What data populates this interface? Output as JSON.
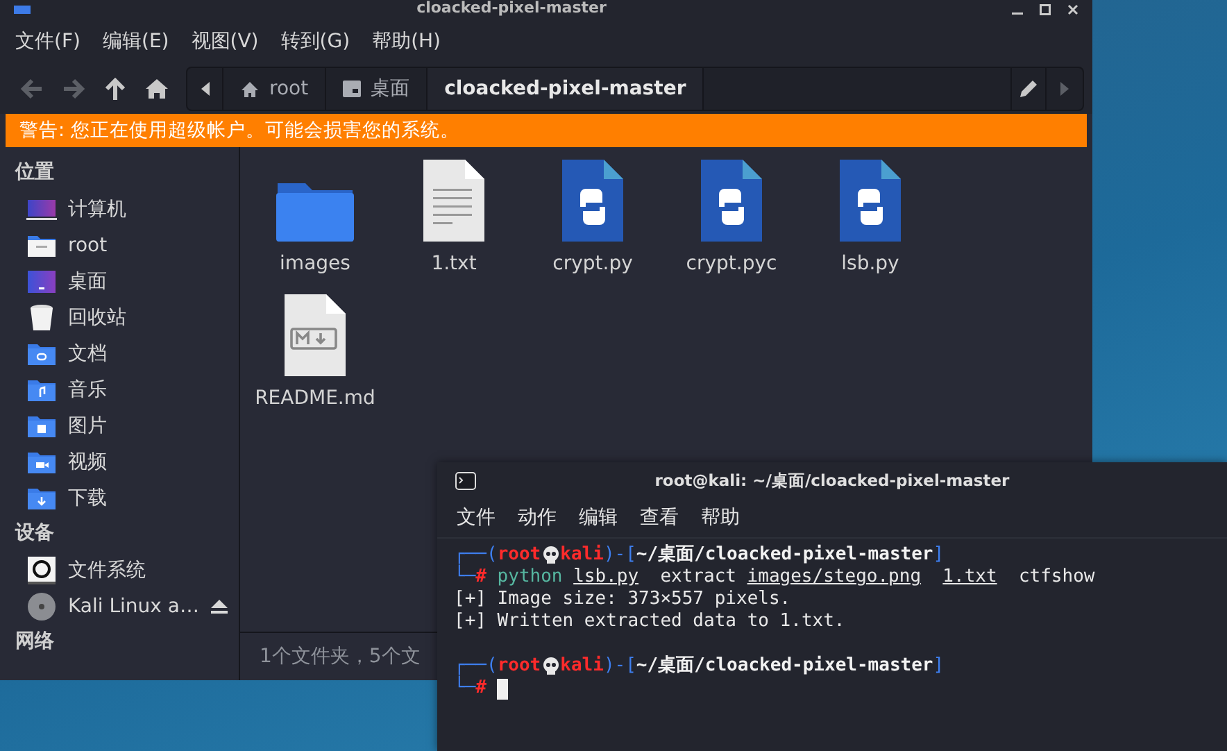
{
  "file_manager": {
    "title": "cloacked-pixel-master",
    "menu": [
      "文件(F)",
      "编辑(E)",
      "视图(V)",
      "转到(G)",
      "帮助(H)"
    ],
    "path": [
      {
        "label": "root",
        "kind": "home",
        "selected": false
      },
      {
        "label": "桌面",
        "kind": "desktop",
        "selected": false
      },
      {
        "label": "cloacked-pixel-master",
        "kind": "plain",
        "selected": true
      }
    ],
    "warning": "警告: 您正在使用超级帐户。可能会损害您的系统。",
    "sidebar": [
      {
        "heading": "位置",
        "items": [
          {
            "label": "计算机",
            "kind": "computer"
          },
          {
            "label": "root",
            "kind": "home"
          },
          {
            "label": "桌面",
            "kind": "desktop"
          },
          {
            "label": "回收站",
            "kind": "trash"
          },
          {
            "label": "文档",
            "kind": "documents"
          },
          {
            "label": "音乐",
            "kind": "music"
          },
          {
            "label": "图片",
            "kind": "pictures"
          },
          {
            "label": "视频",
            "kind": "videos"
          },
          {
            "label": "下载",
            "kind": "downloads"
          }
        ]
      },
      {
        "heading": "设备",
        "items": [
          {
            "label": "文件系统",
            "kind": "disk"
          },
          {
            "label": "Kali Linux a…",
            "kind": "optical",
            "eject": true
          }
        ]
      },
      {
        "heading": "网络"
      }
    ],
    "files": [
      {
        "name": "images",
        "kind": "folder"
      },
      {
        "name": "1.txt",
        "kind": "text"
      },
      {
        "name": "crypt.py",
        "kind": "python"
      },
      {
        "name": "crypt.pyc",
        "kind": "python"
      },
      {
        "name": "lsb.py",
        "kind": "python"
      },
      {
        "name": "README.md",
        "kind": "markdown"
      }
    ],
    "status": "1个文件夹，5个文"
  },
  "terminal": {
    "title": "root@kali: ~/桌面/cloacked-pixel-master",
    "menu": [
      "文件",
      "动作",
      "编辑",
      "查看",
      "帮助"
    ],
    "lines": [
      {
        "kind": "prompt",
        "open": "┌──(",
        "user": "root",
        "host": "kali",
        "mid": ")-[",
        "path": "~/桌面/cloacked-pixel-master",
        "close": "]"
      },
      {
        "kind": "input",
        "corner": "└─",
        "hash": "#",
        "program": "python",
        "args": [
          {
            "kind": "file",
            "text": "lsb.py"
          },
          {
            "kind": "word",
            "text": "extract"
          },
          {
            "kind": "file",
            "text": "images/stego.png"
          },
          {
            "kind": "file",
            "text": "1.txt"
          },
          {
            "kind": "word",
            "text": "ctfshow"
          }
        ]
      },
      {
        "kind": "output",
        "text": "[+] Image size: 373×557 pixels."
      },
      {
        "kind": "output",
        "text": "[+] Written extracted data to 1.txt."
      },
      {
        "kind": "blank"
      },
      {
        "kind": "prompt",
        "open": "┌──(",
        "user": "root",
        "host": "kali",
        "mid": ")-[",
        "path": "~/桌面/cloacked-pixel-master",
        "close": "]"
      },
      {
        "kind": "input",
        "corner": "└─",
        "hash": "#",
        "cursor": true
      }
    ]
  }
}
